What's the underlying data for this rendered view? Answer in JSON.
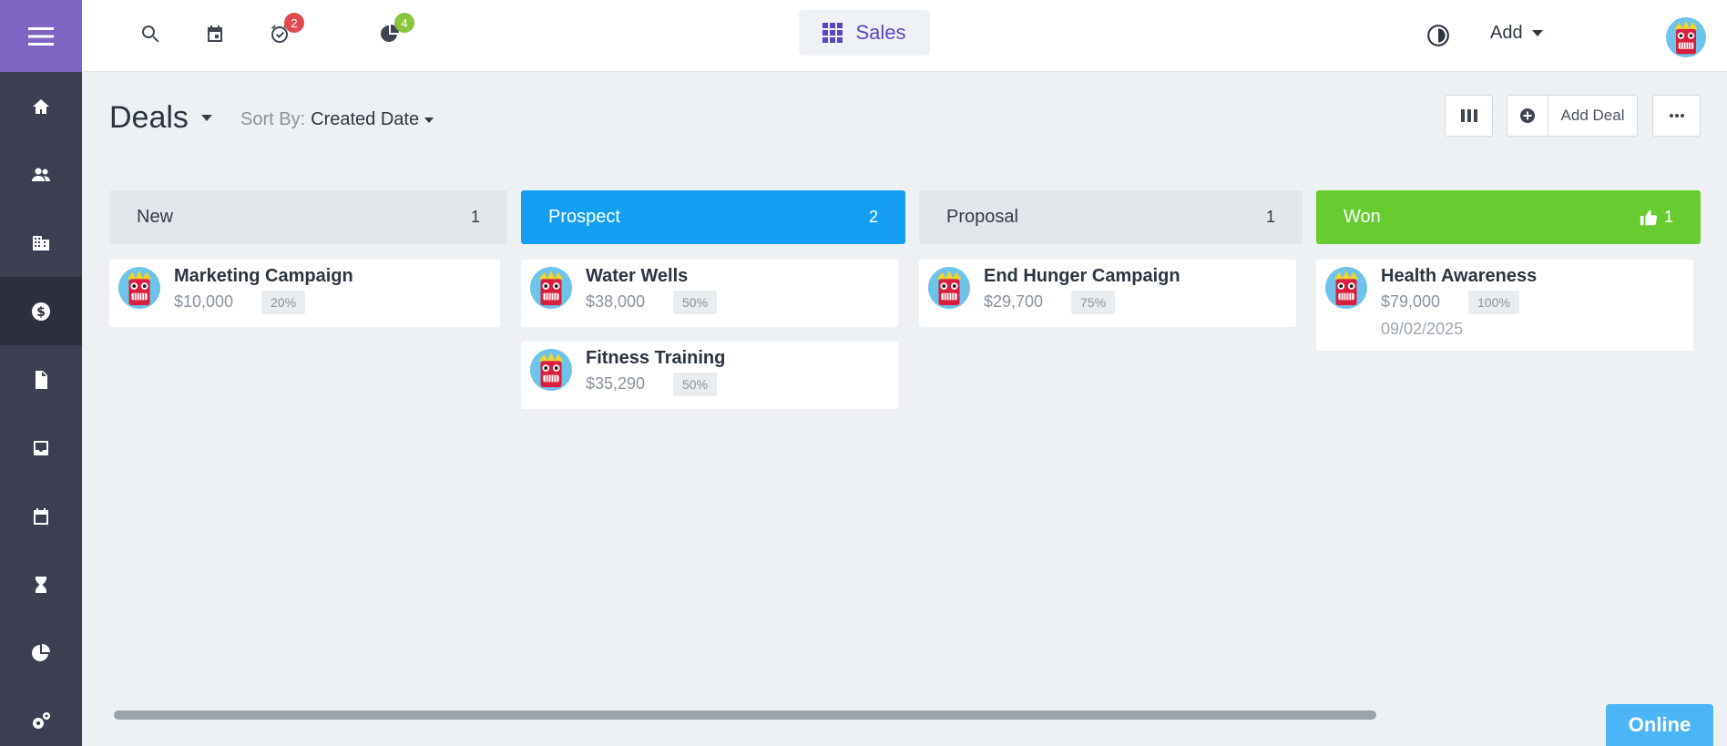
{
  "sidebar": {
    "items": [
      {
        "icon": "home-icon"
      },
      {
        "icon": "contacts-icon"
      },
      {
        "icon": "company-icon"
      },
      {
        "icon": "dollar-icon",
        "active": true
      },
      {
        "icon": "document-icon"
      },
      {
        "icon": "inbox-icon"
      },
      {
        "icon": "calendar-icon"
      },
      {
        "icon": "hourglass-icon"
      },
      {
        "icon": "pie-chart-icon"
      },
      {
        "icon": "gears-icon"
      }
    ]
  },
  "topbar": {
    "tasks_badge": "2",
    "reports_badge": "4",
    "app_name": "Sales",
    "add_label": "Add"
  },
  "page": {
    "title": "Deals",
    "sort_prefix": "Sort By:",
    "sort_value": "Created Date",
    "add_deal_label": "Add Deal"
  },
  "columns": [
    {
      "name": "New",
      "count": "1",
      "color": "#e3e7eb"
    },
    {
      "name": "Prospect",
      "count": "2",
      "color": "#139ef1"
    },
    {
      "name": "Proposal",
      "count": "1",
      "color": "#e3e7eb"
    },
    {
      "name": "Won",
      "count": "1",
      "color": "#66cc2f"
    }
  ],
  "deals": [
    {
      "name": "Marketing Campaign",
      "amount": "$10,000",
      "probability": "20%"
    },
    {
      "name": "Water Wells",
      "amount": "$38,000",
      "probability": "50%"
    },
    {
      "name": "Fitness Training",
      "amount": "$35,290",
      "probability": "50%"
    },
    {
      "name": "End Hunger Campaign",
      "amount": "$29,700",
      "probability": "75%"
    },
    {
      "name": "Health Awareness",
      "amount": "$79,000",
      "probability": "100%",
      "date": "09/02/2025"
    }
  ],
  "status": {
    "online_label": "Online"
  }
}
